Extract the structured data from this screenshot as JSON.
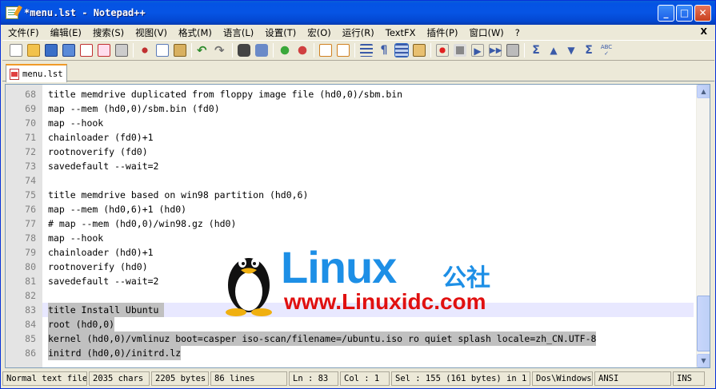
{
  "window": {
    "title": "*menu.lst - Notepad++",
    "min_icon": "minimize-icon",
    "max_icon": "maximize-icon",
    "close_icon": "close-icon"
  },
  "menu": {
    "items": [
      "文件(F)",
      "编辑(E)",
      "搜索(S)",
      "视图(V)",
      "格式(M)",
      "语言(L)",
      "设置(T)",
      "宏(O)",
      "运行(R)",
      "TextFX",
      "插件(P)",
      "窗口(W)",
      "?"
    ],
    "close_label": "X"
  },
  "toolbar": {
    "icons": [
      "new-file-icon",
      "open-file-icon",
      "save-icon",
      "save-all-icon",
      "close-icon",
      "close-all-icon",
      "print-icon",
      "cut-icon",
      "copy-icon",
      "paste-icon",
      "undo-icon",
      "redo-icon",
      "find-icon",
      "replace-icon",
      "zoom-in-icon",
      "zoom-out-icon",
      "sync-vertical-icon",
      "sync-horizontal-icon",
      "word-wrap-icon",
      "show-all-chars-icon",
      "indent-guide-icon",
      "user-lang-icon",
      "record-macro-icon",
      "stop-record-icon",
      "play-macro-icon",
      "run-macro-multiple-icon",
      "save-macro-icon",
      "trim-icon",
      "move-up-icon",
      "move-down-icon",
      "sort-icon",
      "spell-check-icon"
    ]
  },
  "tab": {
    "label": "menu.lst"
  },
  "editor": {
    "lines": [
      {
        "n": "68",
        "text": "title memdrive duplicated from floppy image file (hd0,0)/sbm.bin",
        "sel": false
      },
      {
        "n": "69",
        "text": "map --mem (hd0,0)/sbm.bin (fd0)",
        "sel": false
      },
      {
        "n": "70",
        "text": "map --hook",
        "sel": false
      },
      {
        "n": "71",
        "text": "chainloader (fd0)+1",
        "sel": false
      },
      {
        "n": "72",
        "text": "rootnoverify (fd0)",
        "sel": false
      },
      {
        "n": "73",
        "text": "savedefault --wait=2",
        "sel": false
      },
      {
        "n": "74",
        "text": "",
        "sel": false
      },
      {
        "n": "75",
        "text": "title memdrive based on win98 partition (hd0,6)",
        "sel": false
      },
      {
        "n": "76",
        "text": "map --mem (hd0,6)+1 (hd0)",
        "sel": false
      },
      {
        "n": "77",
        "text": "# map --mem (hd0,0)/win98.gz (hd0)",
        "sel": false
      },
      {
        "n": "78",
        "text": "map --hook",
        "sel": false
      },
      {
        "n": "79",
        "text": "chainloader (hd0)+1",
        "sel": false
      },
      {
        "n": "80",
        "text": "rootnoverify (hd0)",
        "sel": false
      },
      {
        "n": "81",
        "text": "savedefault --wait=2",
        "sel": false
      },
      {
        "n": "82",
        "text": "",
        "sel": false
      },
      {
        "n": "83",
        "text": "title Install Ubuntu ",
        "sel": true
      },
      {
        "n": "84",
        "text": "root (hd0,0)",
        "sel": true
      },
      {
        "n": "85",
        "text": "kernel (hd0,0)/vmlinuz boot=casper iso-scan/filename=/ubuntu.iso ro quiet splash locale=zh_CN.UTF-8",
        "sel": true
      },
      {
        "n": "86",
        "text": "initrd (hd0,0)/initrd.lz",
        "sel": true
      }
    ]
  },
  "watermark": {
    "brand": "Linux",
    "brand_cn": "公社",
    "url": "www.Linuxidc.com"
  },
  "status": {
    "filetype": "Normal text file",
    "chars": "2035 chars",
    "bytes": "2205 bytes",
    "lines": "86 lines",
    "ln": "Ln : 83",
    "col": "Col : 1",
    "sel": "Sel : 155 (161 bytes) in 1",
    "eol": "Dos\\Windows",
    "enc": "ANSI",
    "mode": "INS"
  },
  "colors": {
    "accent": "#0654e4",
    "watermark_blue": "#1d8fe6",
    "watermark_red": "#e01010",
    "selection": "#c0c0c0"
  }
}
